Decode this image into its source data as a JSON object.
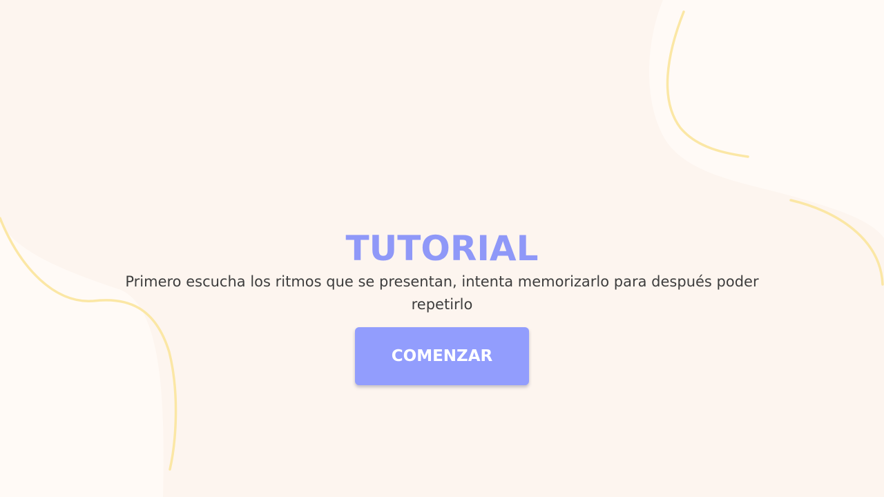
{
  "tutorial": {
    "title": "TUTORIAL",
    "description": "Primero escucha los ritmos que se presentan, intenta memorizarlo para después poder repetirlo",
    "start_button_label": "COMENZAR"
  },
  "colors": {
    "background": "#fdf5ef",
    "blob": "#fffaf6",
    "accent": "#8f98f8",
    "button": "#929dfd",
    "decorative_line": "#fbe7a5",
    "text": "#3d3d3d"
  }
}
